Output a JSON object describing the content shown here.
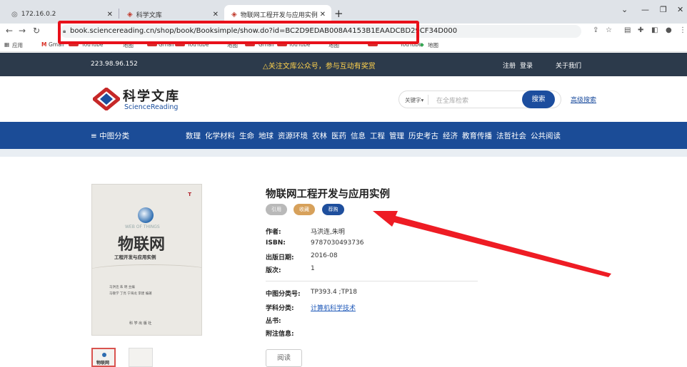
{
  "browser": {
    "tabs": [
      {
        "label": "172.16.0.2",
        "icon": "globe-icon"
      },
      {
        "label": "科学文库",
        "icon": "sciencereading-icon"
      },
      {
        "label": "物联网工程开发与应用实例",
        "icon": "sciencereading-icon"
      }
    ],
    "new_tab": "+",
    "url": "book.sciencereading.cn/shop/book/Booksimple/show.do?id=BC2D9EDAB008A4153B1EAADCBD29CF34D000",
    "bookmarks": [
      "应用",
      "Gmail",
      "YouTube",
      "地图",
      "Gmail",
      "YouTube",
      "地图",
      "Gmail",
      "YouTube",
      "地图"
    ],
    "bookmarks_last": "地图"
  },
  "site": {
    "ip": "223.98.96.152",
    "notice": "△关注文库公众号，参与互动有奖赏",
    "register": "注册",
    "login": "登录",
    "about": "关于我们",
    "logo_cn": "科学文库",
    "logo_en": "ScienceReading",
    "search_keyword": "关键字▾",
    "search_placeholder": "在全库检索",
    "search_button": "搜索",
    "advanced_search": "高级搜索",
    "category_menu": "≡ 中图分类",
    "nav_items": [
      "数理",
      "化学材料",
      "生命",
      "地球",
      "资源环境",
      "农林",
      "医药",
      "信息",
      "工程",
      "管理",
      "历史考古",
      "经济",
      "教育传播",
      "法哲社会",
      "公共阅读"
    ]
  },
  "book": {
    "title": "物联网工程开发与应用实例",
    "actions": {
      "cite": "引用",
      "favorite": "收藏",
      "buy": "荐购"
    },
    "author_label": "作者:",
    "author": "马洪连,朱明",
    "isbn_label": "ISBN:",
    "isbn": "9787030493736",
    "date_label": "出版日期:",
    "date": "2016-08",
    "edition_label": "版次:",
    "edition": "1",
    "clc_label": "中图分类号:",
    "clc": "TP393.4 ;TP18",
    "subject_label": "学科分类:",
    "subject": "计算机科学技术",
    "series_label": "丛书:",
    "extra_label": "附注信息:",
    "read_button": "阅读",
    "cover": {
      "badge": "T",
      "web_text": "WEB OF THINGS",
      "big_title": "物联网",
      "subtitle": "工程开发与应用实例",
      "authors_line1": "马洪连   朱 明 主编",
      "authors_line2": "马敬学 丁亮 宁海龙 李建 编著",
      "publisher": "科 学 出 版 社"
    }
  },
  "colors": {
    "highlight_red": "#e8101a",
    "nav_blue": "#1b4c97",
    "top_strip": "#2c3a4b",
    "notice_yellow": "#ffd24d",
    "pill_cite": "#b9b9b9",
    "pill_favorite": "#d7a15b",
    "pill_buy": "#1f4f9d"
  }
}
